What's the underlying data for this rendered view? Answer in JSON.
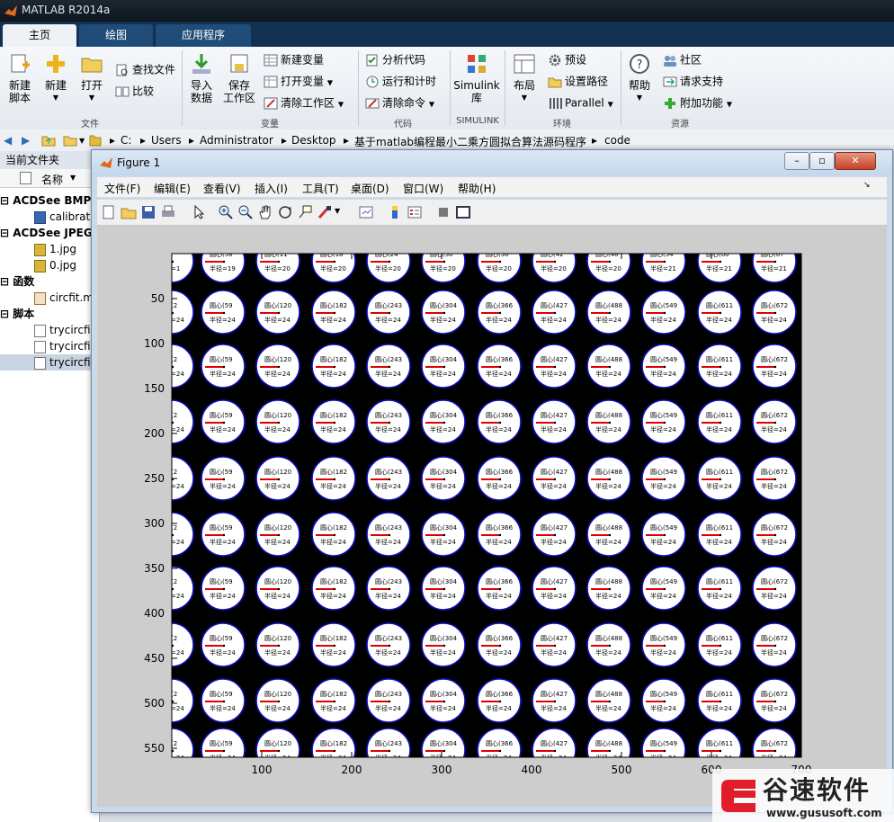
{
  "app": {
    "title": "MATLAB R2014a"
  },
  "tabs": [
    {
      "label": "主页"
    },
    {
      "label": "绘图"
    },
    {
      "label": "应用程序"
    }
  ],
  "ribbon": {
    "file": {
      "new_script": [
        "新建",
        "脚本"
      ],
      "new": "新建",
      "open": "打开",
      "find_files": "查找文件",
      "compare": "比较",
      "section": "文件"
    },
    "variable": {
      "import": [
        "导入",
        "数据"
      ],
      "save": [
        "保存",
        "工作区"
      ],
      "new_var": "新建变量",
      "open_var": "打开变量",
      "clear_ws": "清除工作区",
      "section": "变量"
    },
    "code": {
      "analyze": "分析代码",
      "run_time": "运行和计时",
      "clear_cmd": "清除命令",
      "section": "代码"
    },
    "simulink": {
      "lib": [
        "Simulink",
        "库"
      ],
      "section": "SIMULINK"
    },
    "env": {
      "layout": "布局",
      "prefs": "预设",
      "set_path": "设置路径",
      "parallel": "Parallel",
      "section": "环境"
    },
    "resources": {
      "help": "帮助",
      "community": "社区",
      "support": "请求支持",
      "addons": "附加功能",
      "section": "资源"
    }
  },
  "address": {
    "path": [
      "C:",
      "Users",
      "Administrator",
      "Desktop",
      "基于matlab编程最小二乘方圆拟合算法源码程序",
      "code"
    ]
  },
  "file_panel": {
    "title": "当前文件夹",
    "name_col": "名称",
    "groups": [
      {
        "label": "ACDSee BMP",
        "items": [
          "calibrat"
        ]
      },
      {
        "label": "ACDSee JPEG",
        "items": [
          "1.jpg",
          "0.jpg"
        ]
      },
      {
        "label": "函数",
        "items": [
          "circfit.m"
        ]
      },
      {
        "label": "脚本",
        "items": [
          "trycircfi",
          "trycircfi",
          "trycircfi"
        ]
      }
    ]
  },
  "figure": {
    "title": "Figure 1",
    "menu": [
      "文件(F)",
      "编辑(E)",
      "查看(V)",
      "插入(I)",
      "工具(T)",
      "桌面(D)",
      "窗口(W)",
      "帮助(H)"
    ],
    "win_buttons": [
      "–",
      "▫",
      "✕"
    ]
  },
  "chart_data": {
    "type": "scatter",
    "title": "",
    "xlabel": "",
    "ylabel": "",
    "xlim": [
      0,
      700
    ],
    "ylim": [
      560,
      0
    ],
    "xticks": [
      100,
      200,
      300,
      400,
      500,
      600,
      700
    ],
    "yticks": [
      50,
      100,
      150,
      200,
      250,
      300,
      350,
      400,
      450,
      500,
      550
    ],
    "grid": false,
    "background": "#000000",
    "circle_color": "#1010c0",
    "radius_line_color": "#e00000",
    "col_x": [
      0,
      57,
      118,
      180,
      241,
      302,
      364,
      425,
      486,
      547,
      609,
      670
    ],
    "row_y": [
      8,
      65,
      125,
      187,
      250,
      312,
      372,
      435,
      497,
      552
    ],
    "radius": 24,
    "center_label_prefix": "圆心(",
    "radius_label": "半径=24",
    "top_row_labels": [
      "",
      "圆心(58",
      "圆心(11",
      "圆心(18",
      "圆心(24",
      "圆心(30",
      "圆心(36",
      "圆心(42",
      "圆心(48",
      "圆心(54",
      "圆心(60",
      "圆心(67"
    ],
    "top_row_radius": [
      "半径=1",
      "半径=19",
      "半径=20",
      "半径=20",
      "半径=20",
      "半径=20",
      "半径=20",
      "半径=20",
      "半径=20",
      "半径=21",
      "半径=21",
      "半径=21"
    ]
  },
  "watermark": {
    "title": "谷速软件",
    "url": "www.gususoft.com"
  },
  "colors": {
    "accent": "#12304f",
    "tab_active": "#eef2f6",
    "figure_bg": "#c9daea"
  }
}
